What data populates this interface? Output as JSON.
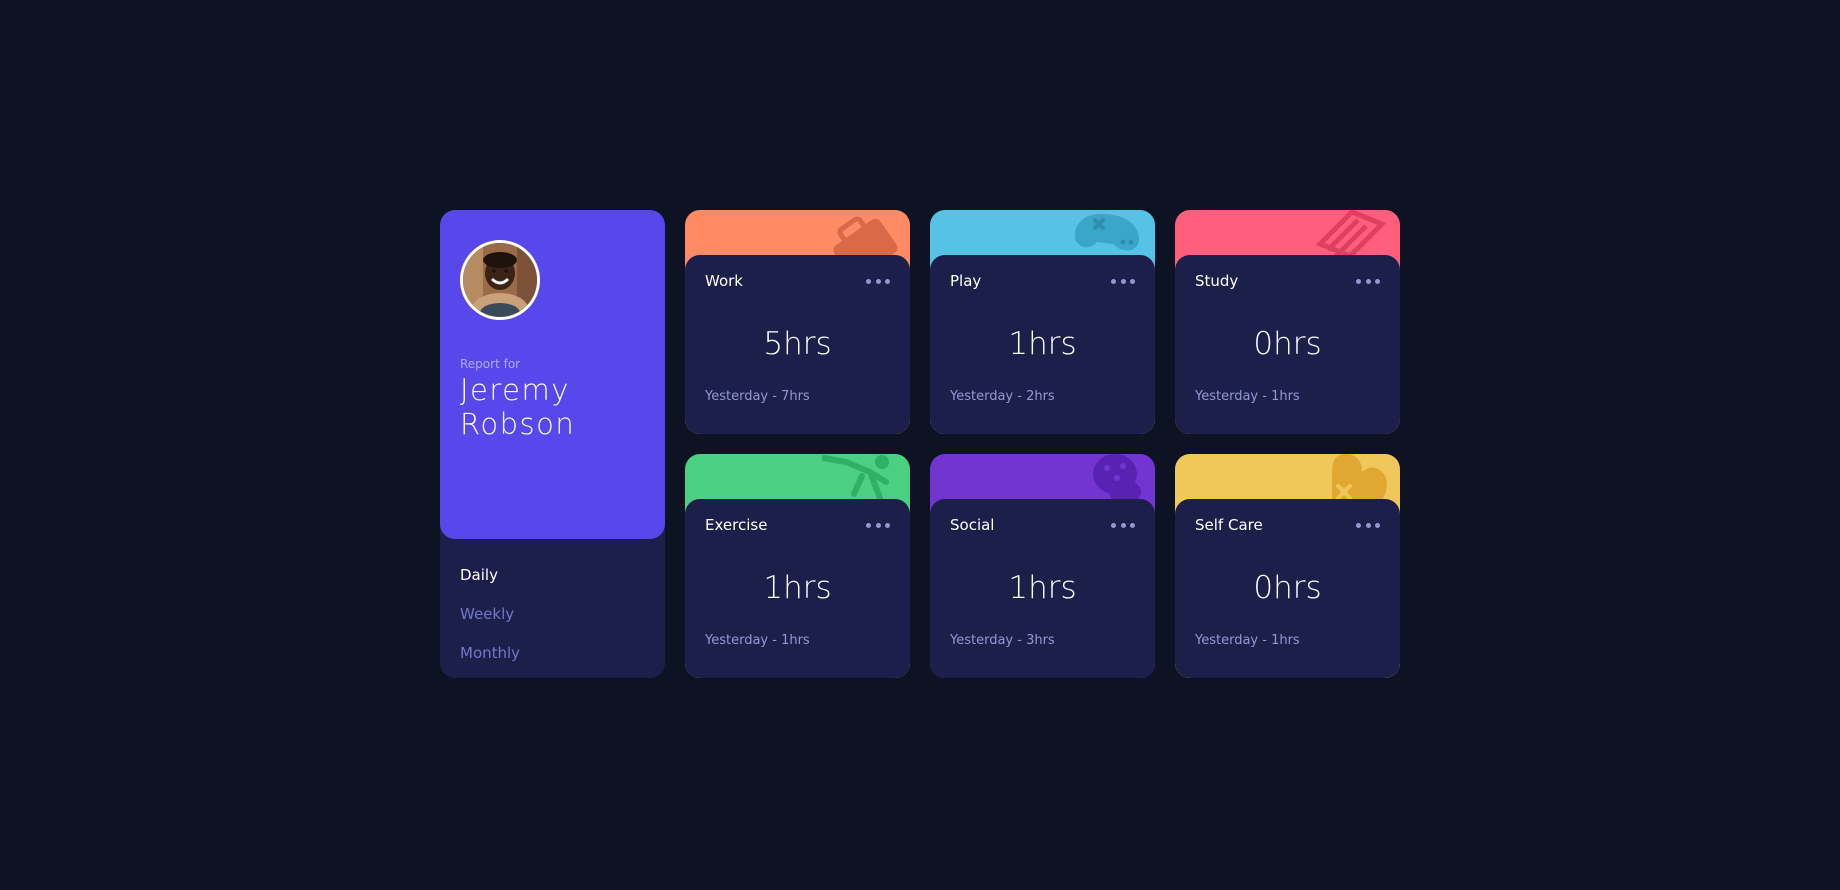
{
  "profile": {
    "report_for": "Report for",
    "name": "Jeremy Robson",
    "periods": [
      "Daily",
      "Weekly",
      "Monthly"
    ],
    "active_period": "Daily"
  },
  "activities": [
    {
      "title": "Work",
      "hours": "5hrs",
      "previous": "Yesterday - 7hrs",
      "color": "#ff8b64",
      "icon": "work-briefcase-icon"
    },
    {
      "title": "Play",
      "hours": "1hrs",
      "previous": "Yesterday - 2hrs",
      "color": "#55c2e6",
      "icon": "play-gamepad-icon"
    },
    {
      "title": "Study",
      "hours": "0hrs",
      "previous": "Yesterday - 1hrs",
      "color": "#ff5e7d",
      "icon": "study-books-icon"
    },
    {
      "title": "Exercise",
      "hours": "1hrs",
      "previous": "Yesterday - 1hrs",
      "color": "#4bcf82",
      "icon": "exercise-runner-icon"
    },
    {
      "title": "Social",
      "hours": "1hrs",
      "previous": "Yesterday - 3hrs",
      "color": "#7335d2",
      "icon": "social-bubbles-icon"
    },
    {
      "title": "Self Care",
      "hours": "0hrs",
      "previous": "Yesterday - 1hrs",
      "color": "#f1c75b",
      "icon": "selfcare-heart-icon"
    }
  ],
  "colors": {
    "page_bg": "#0e1323",
    "card_bg": "#1c1f4a",
    "profile_accent": "#5847eb",
    "muted_text": "#bbc0ff"
  }
}
